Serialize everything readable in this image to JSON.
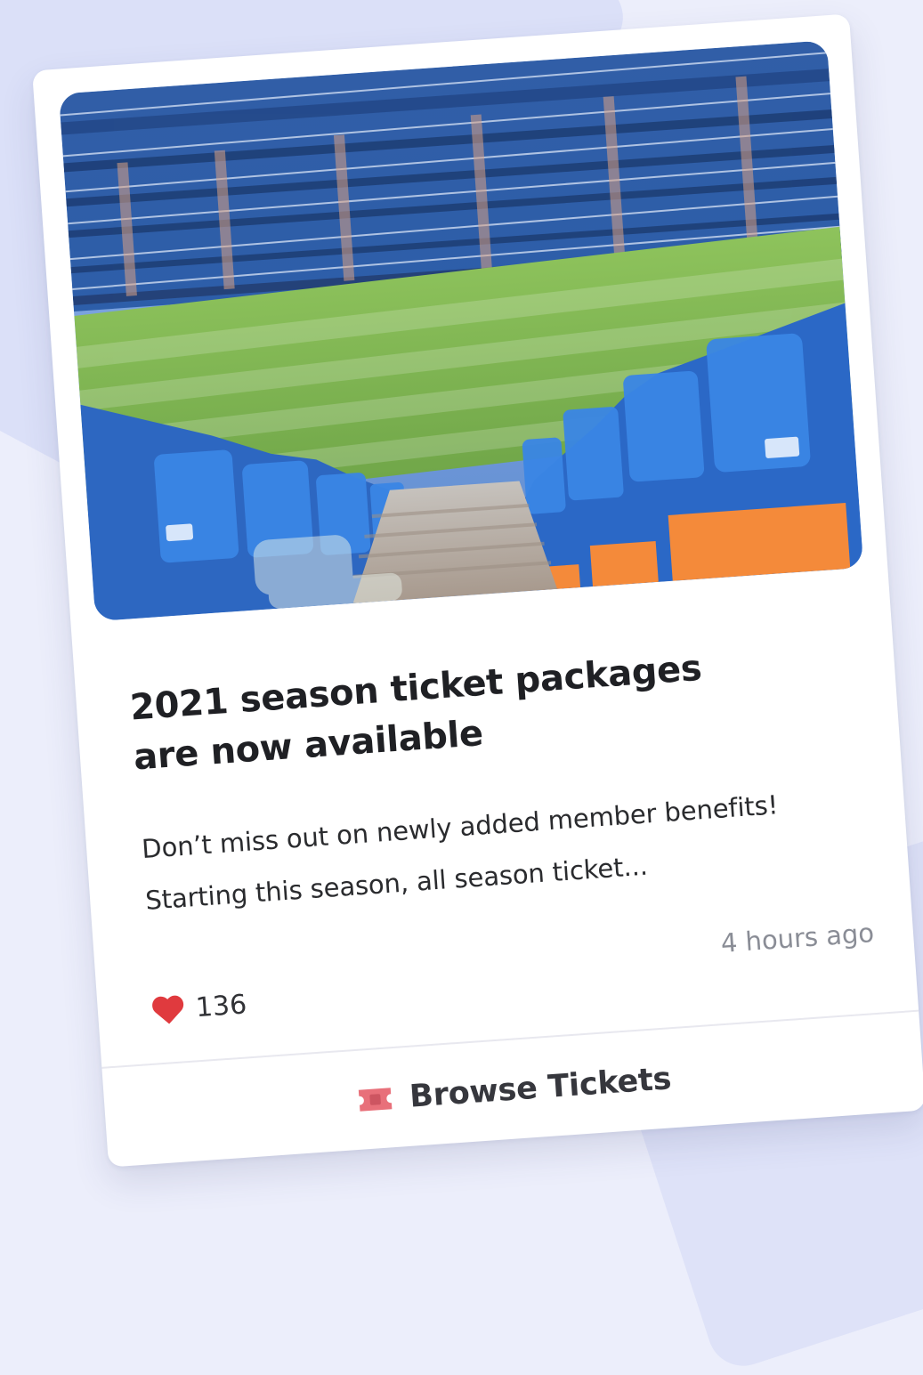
{
  "card": {
    "title": "2021 season ticket packages are now available",
    "description": "Don’t miss out on newly added member benefits! Starting this season, all season ticket...",
    "likes": "136",
    "timestamp": "4 hours ago",
    "action_label": "Browse Tickets",
    "icons": {
      "likes": "heart-icon",
      "action": "ticket-icon"
    },
    "colors": {
      "heart": "#e03a3e",
      "ticket": "#e8707a",
      "title": "#1f2024"
    }
  }
}
